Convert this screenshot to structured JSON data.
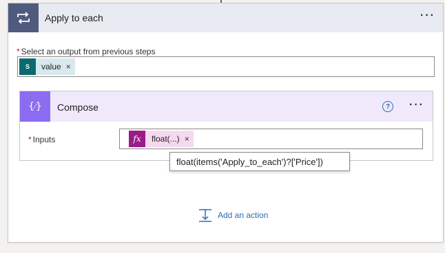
{
  "apply_to_each": {
    "title": "Apply to each",
    "menu_glyph": "···",
    "icon": "loop-icon",
    "output_label": "Select an output from previous steps",
    "required_marker": "*",
    "token": {
      "label": "value",
      "icon": "sharepoint-icon",
      "icon_text": "S",
      "remove_glyph": "×"
    }
  },
  "compose": {
    "title": "Compose",
    "icon": "compose-icon",
    "icon_text": "{⁄}",
    "help_glyph": "?",
    "menu_glyph": "···",
    "inputs_label": "Inputs",
    "required_marker": "*",
    "token": {
      "label": "float(...)",
      "icon": "fx-icon",
      "icon_text": "fx",
      "remove_glyph": "×"
    },
    "tooltip": "float(items('Apply_to_each')?['Price'])"
  },
  "add_action": {
    "label": "Add an action",
    "icon": "add-action-icon"
  },
  "colors": {
    "apply_header": "#e7eaf1",
    "apply_icon_bg": "#4f5b7e",
    "compose_header": "#efe9fb",
    "compose_icon_bg": "#8c6cf0",
    "sharepoint": "#0b6a6f",
    "fx": "#9b1c88",
    "link": "#2b6cb0",
    "required": "#a4262c"
  }
}
